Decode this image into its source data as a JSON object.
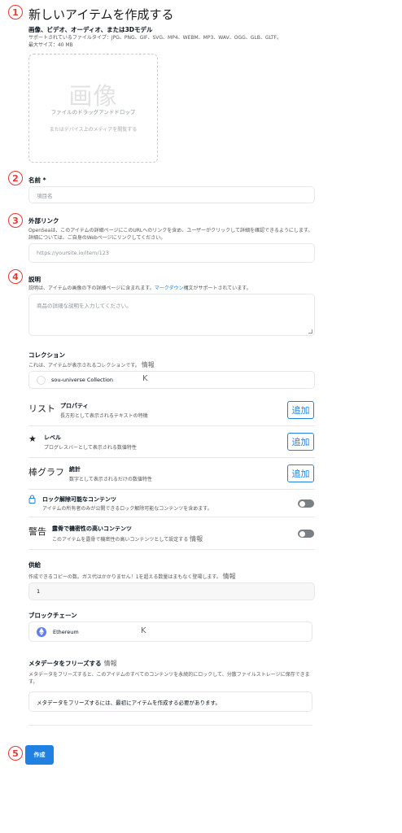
{
  "page": {
    "title": "新しいアイテムを作成する",
    "step_numbers": [
      "1",
      "2",
      "3",
      "4",
      "5"
    ]
  },
  "media": {
    "label": "画像、ビデオ、オーディオ、または3Dモデル",
    "types": "サポートされているファイルタイプ：JPG、PNG、GIF、SVG、MP4、WEBM、MP3、WAV、OGG、GLB、GLTF。",
    "max_size": "最大サイズ：40 MB",
    "drop_big": "画像",
    "drop_text": "ファイルのドラッグアンドドロップ",
    "drop_sub": "またはデバイス上のメディアを閲覧する"
  },
  "name": {
    "label": "名前 *",
    "placeholder": "項目名"
  },
  "external_link": {
    "label": "外部リンク",
    "desc": "OpenSeaは、このアイテムの詳細ページにこのURLへのリンクを含め、ユーザーがクリックして詳細を確認できるようにします。詳細については、ご自身のWebページにリンクしてください。",
    "placeholder": "https://yoursite.io/item/123"
  },
  "description": {
    "label": "説明",
    "desc_before": "説明は、アイテムの画像の下の詳細ページに含まれます。",
    "desc_link": "マークダウン",
    "desc_after": "構文がサポートされています。",
    "placeholder": "商品の詳細な説明を入力してください。"
  },
  "collection": {
    "label": "コレクション",
    "desc": "これは、アイテムが表示されるコレクションです。",
    "info": "情報",
    "value": "sou-universe Collection",
    "k": "K"
  },
  "properties": {
    "icon_text": "リスト",
    "title": "プロパティ",
    "desc": "長方形として表示されるテキストの特徴",
    "button": "追加"
  },
  "levels": {
    "icon": "★",
    "title": "レベル",
    "desc": "プログレスバーとして表示される数値特性",
    "button": "追加"
  },
  "stats": {
    "icon_text": "棒グラフ",
    "title": "統計",
    "desc": "数字として表示されるだけの数値特性",
    "button": "追加"
  },
  "unlockable": {
    "title": "ロック解除可能なコンテンツ",
    "desc": "アイテムの所有者のみが公開できるロック解除可能なコンテンツを含めます。"
  },
  "sensitive": {
    "icon_text": "警告",
    "title": "露骨で機密性の高いコンテンツ",
    "desc": "このアイテムを露骨で機密性の高いコンテンツとして設定する",
    "info": "情報"
  },
  "supply": {
    "label": "供給",
    "desc": "作成できるコピーの数。ガス代はかかりません！1を超える数量はまもなく登場します。",
    "info": "情報",
    "value": "1"
  },
  "blockchain": {
    "label": "ブロックチェーン",
    "value": "Ethereum",
    "k": "K"
  },
  "freeze": {
    "label": "メタデータをフリーズする",
    "info": "情報",
    "desc": "メタデータをフリーズすると、このアイテムのすべてのコンテンツを永続的にロックして、分散ファイルストレージに保存できます。",
    "placeholder": "メタデータをフリーズするには、最初にアイテムを作成する必要があります。"
  },
  "create_button": "作成",
  "colors": {
    "accent": "#2081e2",
    "step_marker": "#e53935",
    "toggle_off": "#7a7f84",
    "ethereum": "#627eea"
  }
}
